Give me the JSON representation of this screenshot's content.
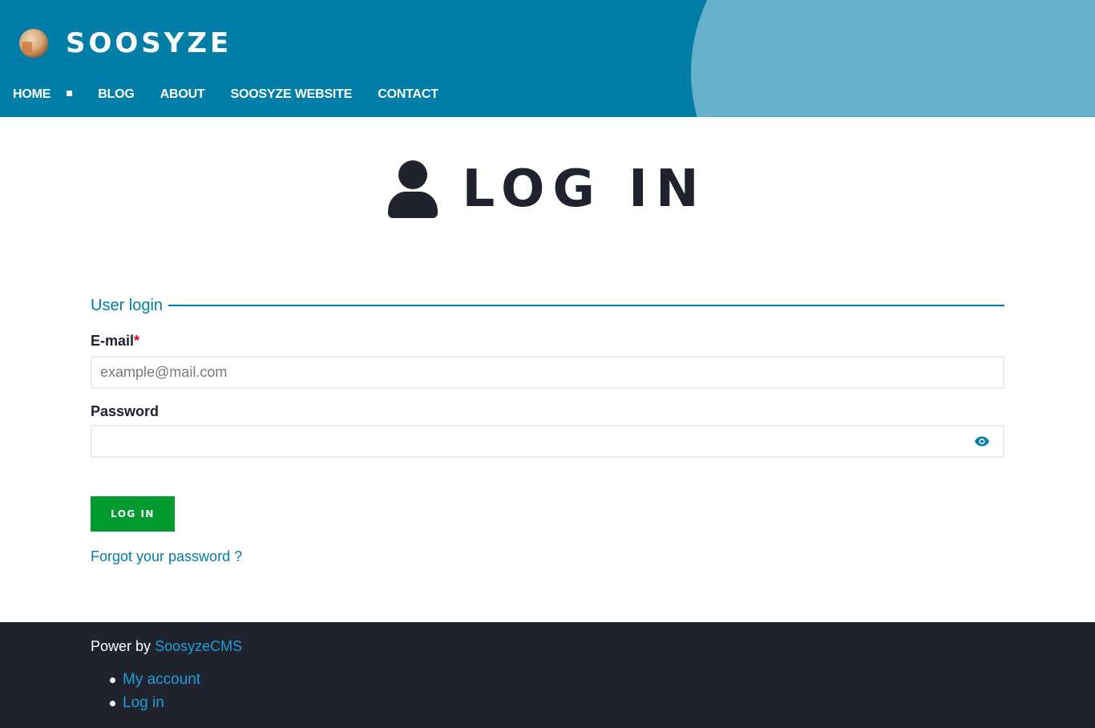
{
  "site": {
    "name": "SOOSYZE",
    "logo_icon": "logo-icon"
  },
  "nav": {
    "items": [
      {
        "label": "HOME",
        "active": true
      },
      {
        "label": "BLOG"
      },
      {
        "label": "ABOUT"
      },
      {
        "label": "SOOSYZE WEBSITE"
      },
      {
        "label": "CONTACT"
      }
    ]
  },
  "page": {
    "title": "LOG IN",
    "title_icon": "user-icon"
  },
  "form": {
    "legend": "User login",
    "email": {
      "label": "E-mail",
      "required_mark": "*",
      "placeholder": "example@mail.com",
      "value": ""
    },
    "password": {
      "label": "Password",
      "value": "",
      "toggle_icon": "eye-icon"
    },
    "submit_label": "LOG IN",
    "forgot_link": "Forgot your password ?"
  },
  "footer": {
    "powered_text": "Power by",
    "powered_link": "SoosyzeCMS",
    "links": [
      {
        "label": "My account"
      },
      {
        "label": "Log in"
      }
    ]
  },
  "colors": {
    "header_bg": "#007ea8",
    "header_accent": "#66b2cc",
    "primary": "#007ea8",
    "button": "#009a2e",
    "footer_bg": "#20222e",
    "link_footer": "#1ba0d8",
    "required": "#d0021b"
  }
}
